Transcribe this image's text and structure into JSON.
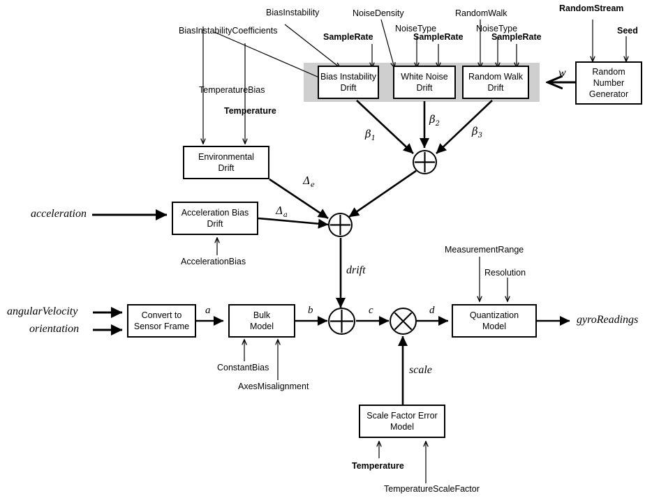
{
  "diagram": {
    "title": "Gyroscope Sensor Model Block Diagram",
    "stroke_color": "#000000",
    "band_color": "#cfcfcf",
    "background": "#ffffff"
  },
  "blocks": {
    "bias_instability_drift": "Bias Instability\nDrift",
    "white_noise_drift": "White Noise\nDrift",
    "random_walk_drift": "Random Walk\nDrift",
    "random_number_generator": "Random\nNumber\nGenerator",
    "environmental_drift": "Environmental\nDrift",
    "acceleration_bias_drift": "Acceleration Bias\nDrift",
    "convert_to_sensor_frame": "Convert to\nSensor Frame",
    "bulk_model": "Bulk\nModel",
    "quantization_model": "Quantization\nModel",
    "scale_factor_error_model": "Scale Factor Error\nModel"
  },
  "parameters": {
    "bias_instability_coefficients": "BiasInstabilityCoefficients",
    "bias_instability": "BiasInstability",
    "sample_rate_1": "SampleRate",
    "noise_density": "NoiseDensity",
    "noise_type_1": "NoiseType",
    "sample_rate_2": "SampleRate",
    "random_walk": "RandomWalk",
    "noise_type_2": "NoiseType",
    "sample_rate_3": "SampleRate",
    "random_stream": "RandomStream",
    "seed": "Seed",
    "temperature_bias": "TemperatureBias",
    "temperature_1": "Temperature",
    "acceleration_bias": "AccelerationBias",
    "constant_bias": "ConstantBias",
    "axes_misalignment": "AxesMisalignment",
    "measurement_range": "MeasurementRange",
    "resolution": "Resolution",
    "temperature_2": "Temperature",
    "temperature_scale_factor": "TemperatureScaleFactor"
  },
  "signals": {
    "acceleration": "acceleration",
    "angular_velocity": "angularVelocity",
    "orientation": "orientation",
    "gyro_readings": "gyroReadings",
    "w": "w",
    "beta1": "β",
    "beta1_sub": "1",
    "beta2": "β",
    "beta2_sub": "2",
    "beta3": "β",
    "beta3_sub": "3",
    "delta_e": "Δ",
    "delta_e_sub": "e",
    "delta_a": "Δ",
    "delta_a_sub": "a",
    "drift": "drift",
    "a": "a",
    "b": "b",
    "c": "c",
    "d": "d",
    "scale": "scale"
  }
}
